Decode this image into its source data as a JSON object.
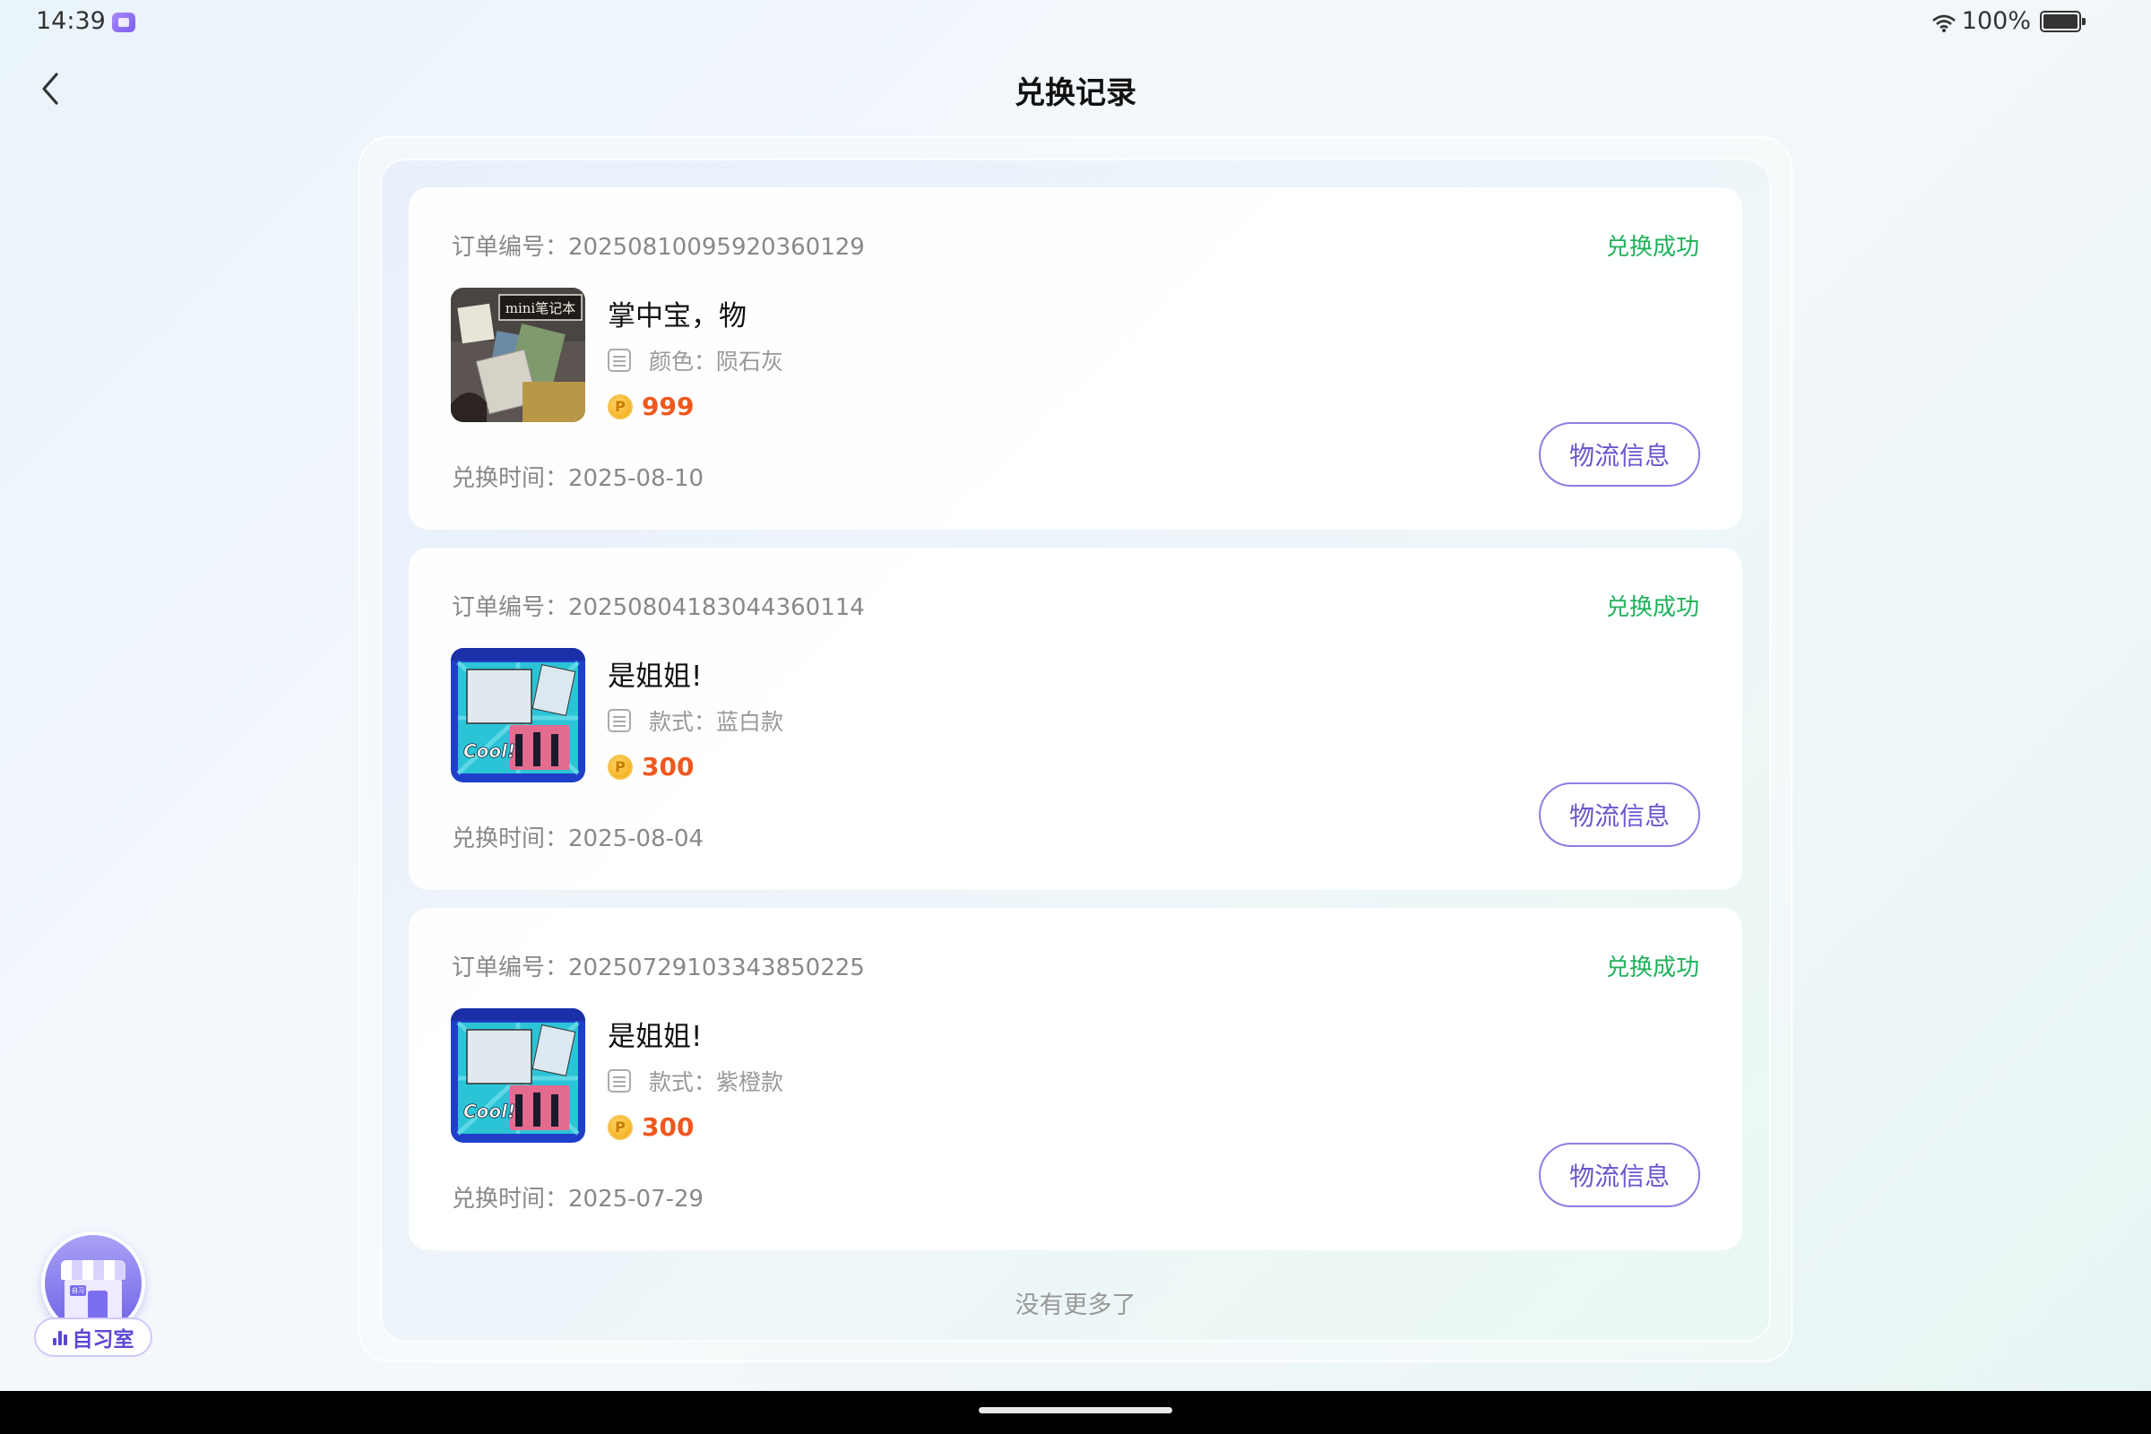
{
  "status_bar": {
    "time": "14:39",
    "battery": "100%"
  },
  "header": {
    "title": "兑换记录"
  },
  "orders": [
    {
      "order_no": "订单编号：20250810095920360129",
      "status": "兑换成功",
      "product_name": "掌中宝，物",
      "spec": "颜色：陨石灰",
      "price": "999",
      "exchange_time": "兑换时间：2025-08-10",
      "logistics_label": "物流信息",
      "image_text": "mini笔记本"
    },
    {
      "order_no": "订单编号：20250804183044360114",
      "status": "兑换成功",
      "product_name": "是姐姐!",
      "spec": "款式：蓝白款",
      "price": "300",
      "exchange_time": "兑换时间：2025-08-04",
      "logistics_label": "物流信息",
      "image_text": "Cool!"
    },
    {
      "order_no": "订单编号：20250729103343850225",
      "status": "兑换成功",
      "product_name": "是姐姐!",
      "spec": "款式：紫橙款",
      "price": "300",
      "exchange_time": "兑换时间：2025-07-29",
      "logistics_label": "物流信息",
      "image_text": "Cool!"
    }
  ],
  "footer": {
    "no_more": "没有更多了"
  },
  "study_room": {
    "label": "自习室",
    "badge": "自习"
  },
  "colors": {
    "success": "#1fb25a",
    "price": "#f0571e",
    "accent": "#6a55cf"
  }
}
